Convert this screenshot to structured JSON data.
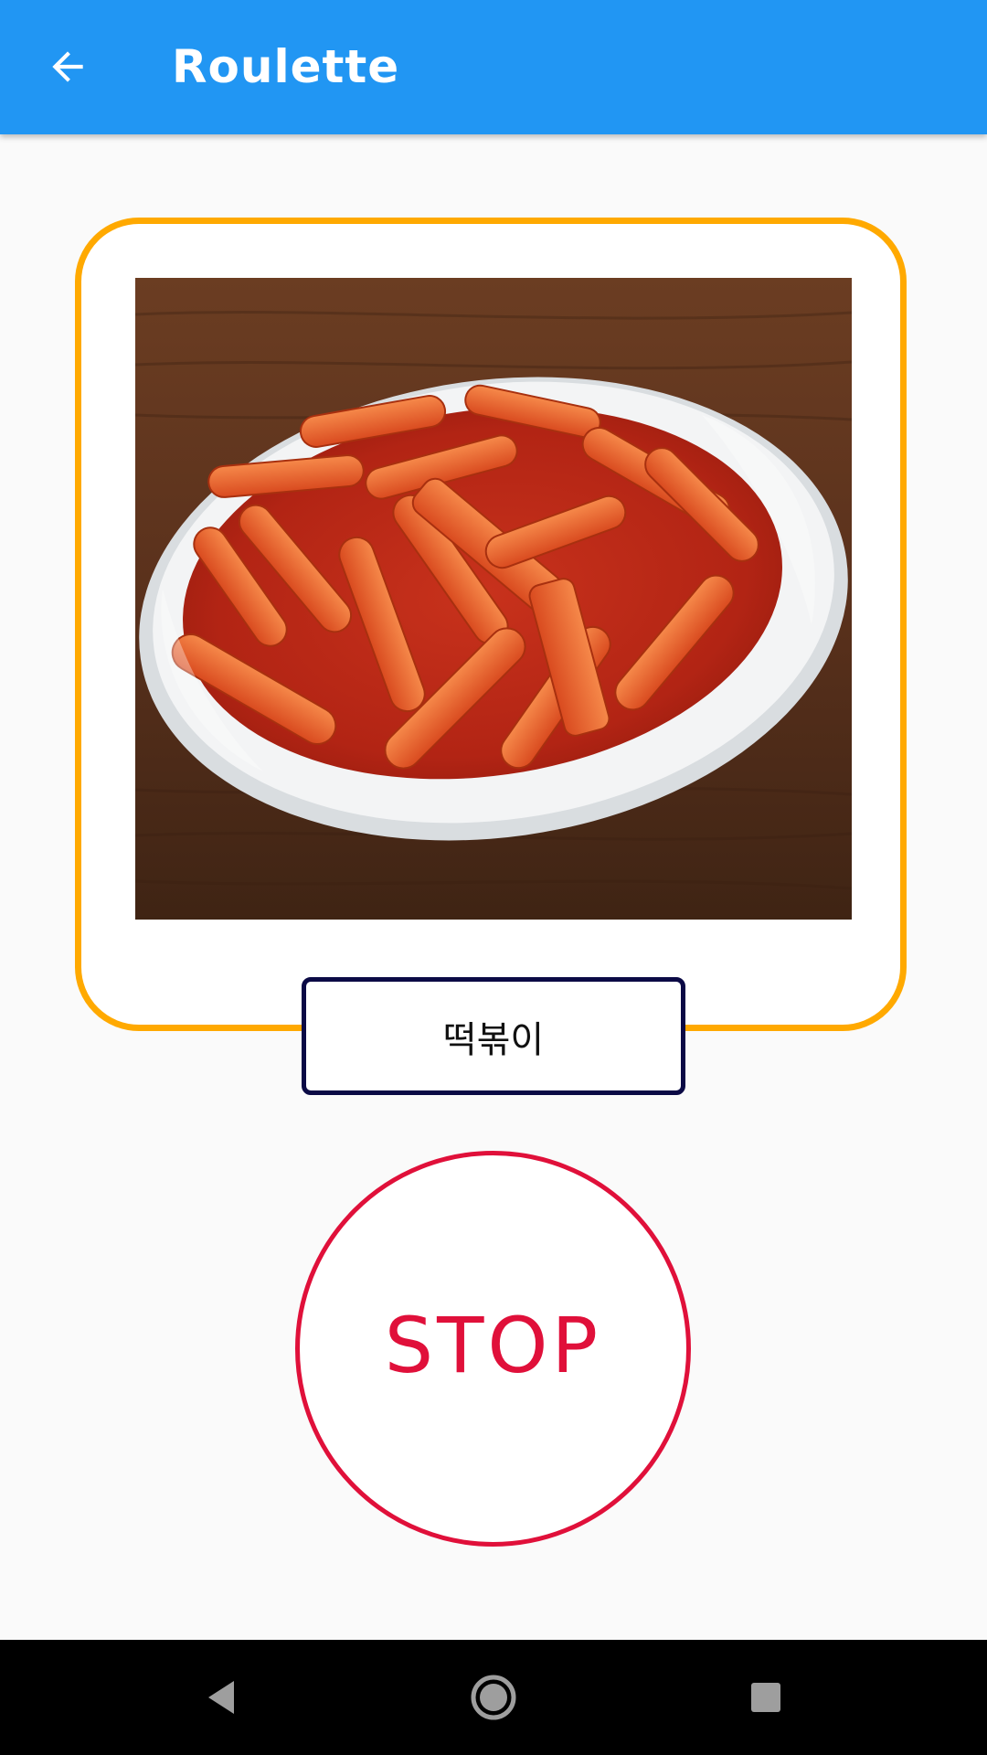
{
  "app_bar": {
    "title": "Roulette",
    "back_icon": "arrow-back-icon",
    "color": "#2196f3"
  },
  "roulette": {
    "frame_color": "#ffa900",
    "image_alt": "tteokbokki",
    "selected_name": "떡볶이"
  },
  "stop_button": {
    "label": "STOP",
    "color": "#e0103a"
  },
  "nav_bar": {
    "back_icon": "triangle-back-icon",
    "home_icon": "circle-home-icon",
    "recent_icon": "square-recents-icon"
  }
}
